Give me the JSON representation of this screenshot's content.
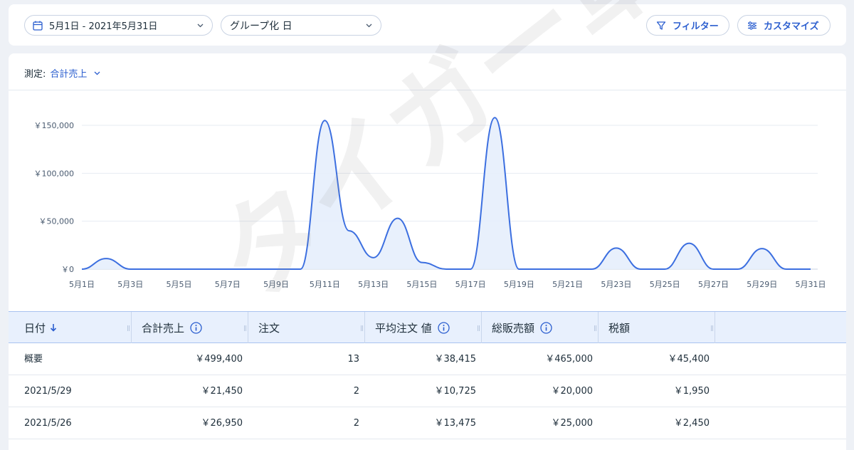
{
  "toolbar": {
    "date_range": "5月1日 - 2021年5月31日",
    "group_by": "グループ化 日",
    "filter_label": "フィルター",
    "customize_label": "カスタマイズ"
  },
  "measure": {
    "label": "測定:",
    "value": "合計売上"
  },
  "colors": {
    "accent": "#2b5ecf",
    "line": "#3c6fe0",
    "fill": "#e6eefc"
  },
  "chart_data": {
    "type": "area",
    "x": [
      "5月1日",
      "5月2日",
      "5月3日",
      "5月4日",
      "5月5日",
      "5月6日",
      "5月7日",
      "5月8日",
      "5月9日",
      "5月10日",
      "5月11日",
      "5月12日",
      "5月13日",
      "5月14日",
      "5月15日",
      "5月16日",
      "5月17日",
      "5月18日",
      "5月19日",
      "5月20日",
      "5月21日",
      "5月22日",
      "5月23日",
      "5月24日",
      "5月25日",
      "5月26日",
      "5月27日",
      "5月28日",
      "5月29日",
      "5月30日",
      "5月31日"
    ],
    "series": [
      {
        "values": [
          0,
          11000,
          0,
          0,
          0,
          0,
          0,
          0,
          0,
          0,
          155000,
          40000,
          12000,
          53000,
          7000,
          0,
          0,
          158000,
          0,
          0,
          0,
          0,
          22000,
          0,
          0,
          27000,
          0,
          0,
          21450,
          0,
          0
        ]
      }
    ],
    "x_tick_labels": [
      "5月1日",
      "5月3日",
      "5月5日",
      "5月7日",
      "5月9日",
      "5月11日",
      "5月13日",
      "5月15日",
      "5月17日",
      "5月19日",
      "5月21日",
      "5月23日",
      "5月25日",
      "5月27日",
      "5月29日",
      "5月31日"
    ],
    "y_tick_labels": [
      "￥0",
      "￥50,000",
      "￥100,000",
      "￥150,000"
    ],
    "y_ticks": [
      0,
      50000,
      100000,
      150000
    ],
    "ylim": [
      0,
      200000
    ],
    "grid": true
  },
  "table": {
    "headers": [
      "日付",
      "合計売上",
      "注文",
      "平均注文 値",
      "総販売額",
      "税額"
    ],
    "sort_icon": "arrow-down-icon",
    "rows": [
      [
        "概要",
        "￥499,400",
        "13",
        "￥38,415",
        "￥465,000",
        "￥45,400"
      ],
      [
        "2021/5/29",
        "￥21,450",
        "2",
        "￥10,725",
        "￥20,000",
        "￥1,950"
      ],
      [
        "2021/5/26",
        "￥26,950",
        "2",
        "￥13,475",
        "￥25,000",
        "￥2,450"
      ]
    ]
  },
  "watermark": "タイガー軍師"
}
